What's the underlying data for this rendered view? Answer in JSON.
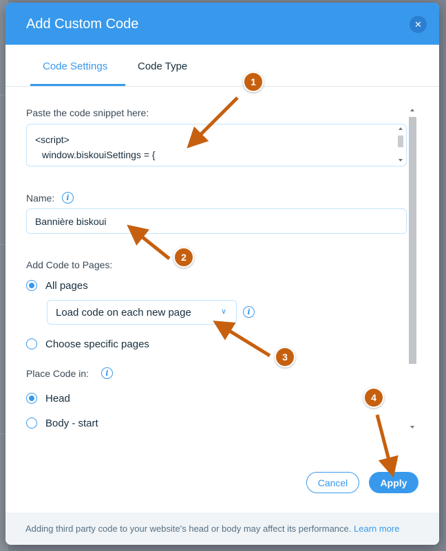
{
  "dialog": {
    "title": "Add Custom Code",
    "close_icon": "close-icon"
  },
  "tabs": [
    {
      "label": "Code Settings",
      "active": true
    },
    {
      "label": "Code Type",
      "active": false
    }
  ],
  "code_snippet": {
    "label": "Paste the code snippet here:",
    "lines": [
      "<script>",
      "window.biskouiSettings = {"
    ]
  },
  "name_field": {
    "label": "Name:",
    "value": "Bannière biskoui"
  },
  "add_code_to_pages": {
    "label": "Add Code to Pages:",
    "options": [
      {
        "label": "All pages",
        "selected": true
      },
      {
        "label": "Choose specific pages",
        "selected": false
      }
    ],
    "load_select": "Load code on each new page"
  },
  "place_code_in": {
    "label": "Place Code in:",
    "options": [
      {
        "label": "Head",
        "selected": true
      },
      {
        "label": "Body - start",
        "selected": false
      }
    ]
  },
  "buttons": {
    "cancel": "Cancel",
    "apply": "Apply"
  },
  "footer": {
    "text": "Adding third party code to your website's head or body may affect its performance.",
    "link": "Learn more"
  },
  "annotations": [
    "1",
    "2",
    "3",
    "4"
  ],
  "colors": {
    "accent": "#3899ec",
    "annotation": "#c6600f"
  }
}
